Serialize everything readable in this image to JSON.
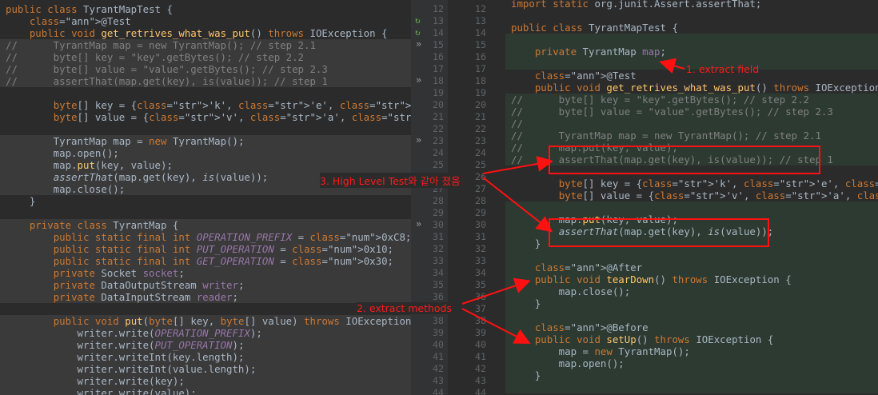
{
  "left_code": [
    {
      "n": "",
      "t": "public class TyrantMapTest {"
    },
    {
      "n": "",
      "t": "    @Test"
    },
    {
      "n": "",
      "t": "    public void get_retrives_what_was_put() throws IOException {"
    },
    {
      "n": "",
      "t": "//      TyrantMap map = new TyrantMap(); // step 2.1"
    },
    {
      "n": "",
      "t": "//      byte[] key = \"key\".getBytes(); // step 2.2"
    },
    {
      "n": "",
      "t": "//      byte[] value = \"value\".getBytes(); // step 2.3"
    },
    {
      "n": "",
      "t": "//      assertThat(map.get(key), is(value)); // step 1"
    },
    {
      "n": "",
      "t": ""
    },
    {
      "n": "",
      "t": "        byte[] key = {'k', 'e', 'y'};"
    },
    {
      "n": "",
      "t": "        byte[] value = {'v', 'a', 'l', 'u', 'e'};"
    },
    {
      "n": "",
      "t": ""
    },
    {
      "n": "",
      "t": "        TyrantMap map = new TyrantMap();"
    },
    {
      "n": "",
      "t": "        map.open();"
    },
    {
      "n": "",
      "t": "        map.put(key, value);"
    },
    {
      "n": "",
      "t": "        assertThat(map.get(key), is(value));"
    },
    {
      "n": "",
      "t": "        map.close();"
    },
    {
      "n": "",
      "t": "    }"
    },
    {
      "n": "",
      "t": ""
    },
    {
      "n": "",
      "t": "    private class TyrantMap {"
    },
    {
      "n": "",
      "t": "        public static final int OPERATION_PREFIX = 0xC8;"
    },
    {
      "n": "",
      "t": "        public static final int PUT_OPERATION = 0x10;"
    },
    {
      "n": "",
      "t": "        public static final int GET_OPERATION = 0x30;"
    },
    {
      "n": "",
      "t": "        private Socket socket;"
    },
    {
      "n": "",
      "t": "        private DataOutputStream writer;"
    },
    {
      "n": "",
      "t": "        private DataInputStream reader;"
    },
    {
      "n": "",
      "t": ""
    },
    {
      "n": "",
      "t": "        public void put(byte[] key, byte[] value) throws IOException {"
    },
    {
      "n": "",
      "t": "            writer.write(OPERATION_PREFIX);"
    },
    {
      "n": "",
      "t": "            writer.write(PUT_OPERATION);"
    },
    {
      "n": "",
      "t": "            writer.writeInt(key.length);"
    },
    {
      "n": "",
      "t": "            writer.writeInt(value.length);"
    },
    {
      "n": "",
      "t": "            writer.write(key);"
    },
    {
      "n": "",
      "t": "            writer.write(value);"
    }
  ],
  "left_line_numbers": [
    "12",
    "13",
    "14",
    "15",
    "16",
    "17",
    "18",
    "19",
    "20",
    "21",
    "22",
    "23",
    "24",
    "25",
    "26",
    "27",
    "28",
    "29",
    "30",
    "31",
    "32",
    "33",
    "34",
    "35",
    "36",
    "37",
    "38",
    "39",
    "40",
    "41",
    "42",
    "43",
    "44"
  ],
  "right_line_numbers": [
    "12",
    "13",
    "14",
    "15",
    "16",
    "17",
    "18",
    "19",
    "20",
    "21",
    "22",
    "23",
    "24",
    "25",
    "26",
    "27",
    "28",
    "29",
    "30",
    "31",
    "32",
    "33",
    "34",
    "35",
    "36",
    "37",
    "38",
    "39",
    "40",
    "41",
    "42",
    "43",
    "44"
  ],
  "right_code": [
    "import static org.junit.Assert.assertThat;",
    "",
    "public class TyrantMapTest {",
    "",
    "    private TyrantMap map;",
    "",
    "    @Test",
    "    public void get_retrives_what_was_put() throws IOException {",
    "//      byte[] key = \"key\".getBytes(); // step 2.2",
    "//      byte[] value = \"value\".getBytes(); // step 2.3",
    "//",
    "//      TyrantMap map = new TyrantMap(); // step 2.1",
    "//      map.put(key, value);",
    "//      assertThat(map.get(key), is(value)); // step 1",
    "",
    "        byte[] key = {'k', 'e', 'y'};",
    "        byte[] value = {'v', 'a', 'l', 'u', 'e'};",
    "",
    "        map.put(key, value);",
    "        assertThat(map.get(key), is(value));",
    "    }",
    "",
    "    @After",
    "    public void tearDown() throws IOException {",
    "        map.close();",
    "    }",
    "",
    "    @Before",
    "    public void setUp() throws IOException {",
    "        map = new TyrantMap();",
    "        map.open();",
    "    }",
    ""
  ],
  "annotations": {
    "extract_field": "1. extract field",
    "extract_methods": "2. extract methods",
    "high_level_test": "3. High Level Test와 같아 졌음"
  },
  "colors": {
    "annotation_red": "#ff1111",
    "diff_green": "#2d3a31",
    "diff_grey": "#3a3a3a"
  }
}
